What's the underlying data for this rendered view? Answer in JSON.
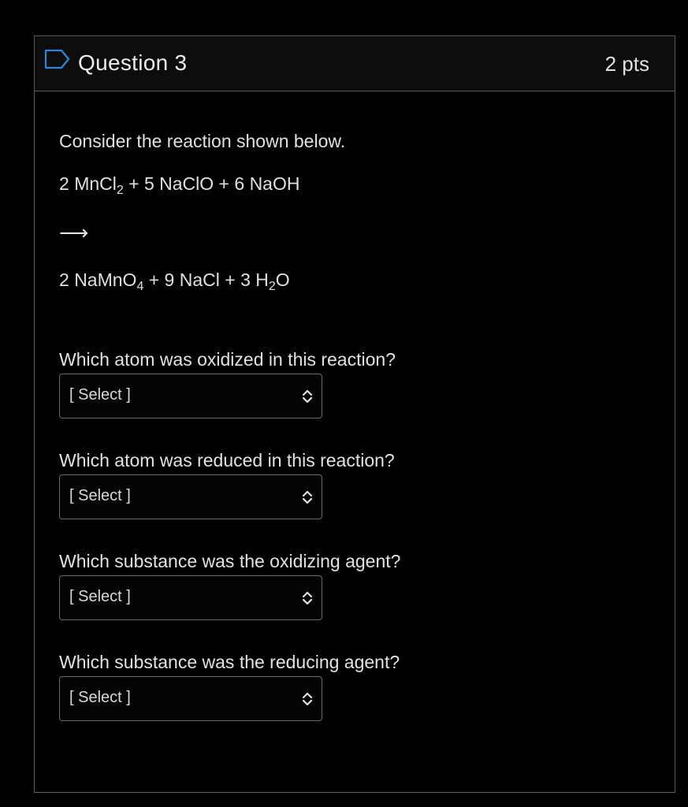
{
  "question": {
    "title": "Question 3",
    "points": "2 pts",
    "icon": "bookmark-icon",
    "intro": "Consider the reaction shown below.",
    "equation": {
      "reactants": {
        "coef1": "2 ",
        "formula1": "MnCl",
        "sub1": "2",
        "join1": " + 5 NaClO + 6 NaOH"
      },
      "arrow": "⟶",
      "products": {
        "coef1": "2 ",
        "formula1": "NaMnO",
        "sub1": "4",
        "join1": " + 9 NaCl + 3 H",
        "sub2": "2",
        "tail": "O"
      }
    },
    "parts": [
      {
        "prompt": "Which atom was oxidized in this reaction?",
        "select": "[ Select ]"
      },
      {
        "prompt": "Which atom was reduced in this reaction?",
        "select": "[ Select ]"
      },
      {
        "prompt": "Which substance was the oxidizing agent?",
        "select": "[ Select ]"
      },
      {
        "prompt": "Which substance was the reducing agent?",
        "select": "[ Select ]"
      }
    ]
  },
  "colors": {
    "background": "#000000",
    "border": "#5a5a5a",
    "text": "#e6e6e6"
  }
}
